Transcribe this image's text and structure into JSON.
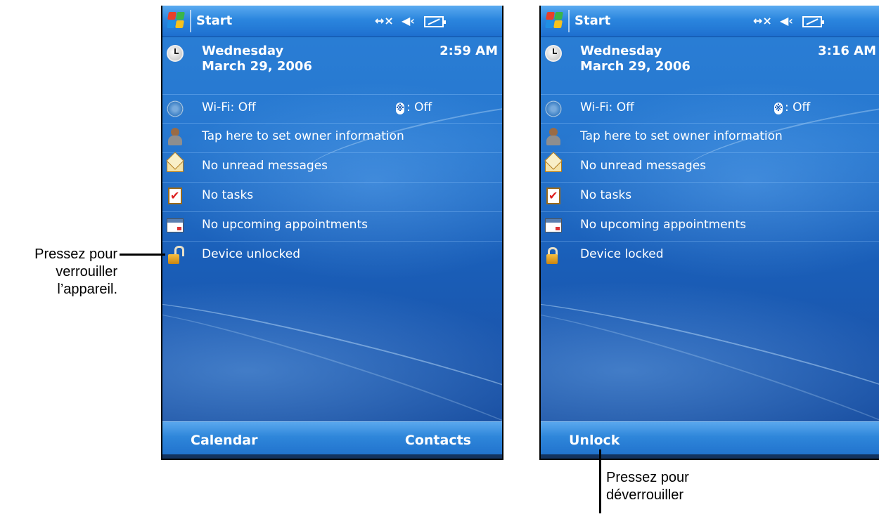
{
  "screens": [
    {
      "start_label": "Start",
      "day": "Wednesday",
      "date": "March 29, 2006",
      "time": "2:59 AM",
      "wifi": "Wi-Fi: Off",
      "bluetooth": ": Off",
      "owner": "Tap here to set owner information",
      "messages": "No unread messages",
      "tasks": "No tasks",
      "appointments": "No upcoming appointments",
      "lock_status": "Device unlocked",
      "softkey_left": "Calendar",
      "softkey_right": "Contacts"
    },
    {
      "start_label": "Start",
      "day": "Wednesday",
      "date": "March 29, 2006",
      "time": "3:16 AM",
      "wifi": "Wi-Fi: Off",
      "bluetooth": ": Off",
      "owner": "Tap here to set owner information",
      "messages": "No unread messages",
      "tasks": "No tasks",
      "appointments": "No upcoming appointments",
      "lock_status": "Device locked",
      "softkey_left": "Unlock"
    }
  ],
  "annotations": {
    "lock_line1": "Pressez pour",
    "lock_line2": "verrouiller",
    "lock_line3": "l’appareil.",
    "unlock_line1": "Pressez pour",
    "unlock_line2": "déverrouiller"
  },
  "icons": {
    "start": "windows-logo-icon",
    "connectivity": "connectivity-icon",
    "volume": "speaker-icon",
    "battery": "battery-icon",
    "clock": "clock-icon",
    "wifi": "wifi-icon",
    "bluetooth": "bluetooth-icon",
    "owner": "person-icon",
    "messages": "envelope-icon",
    "tasks": "task-check-icon",
    "appointments": "calendar-icon",
    "lock_open": "padlock-open-icon",
    "lock_closed": "padlock-closed-icon"
  }
}
